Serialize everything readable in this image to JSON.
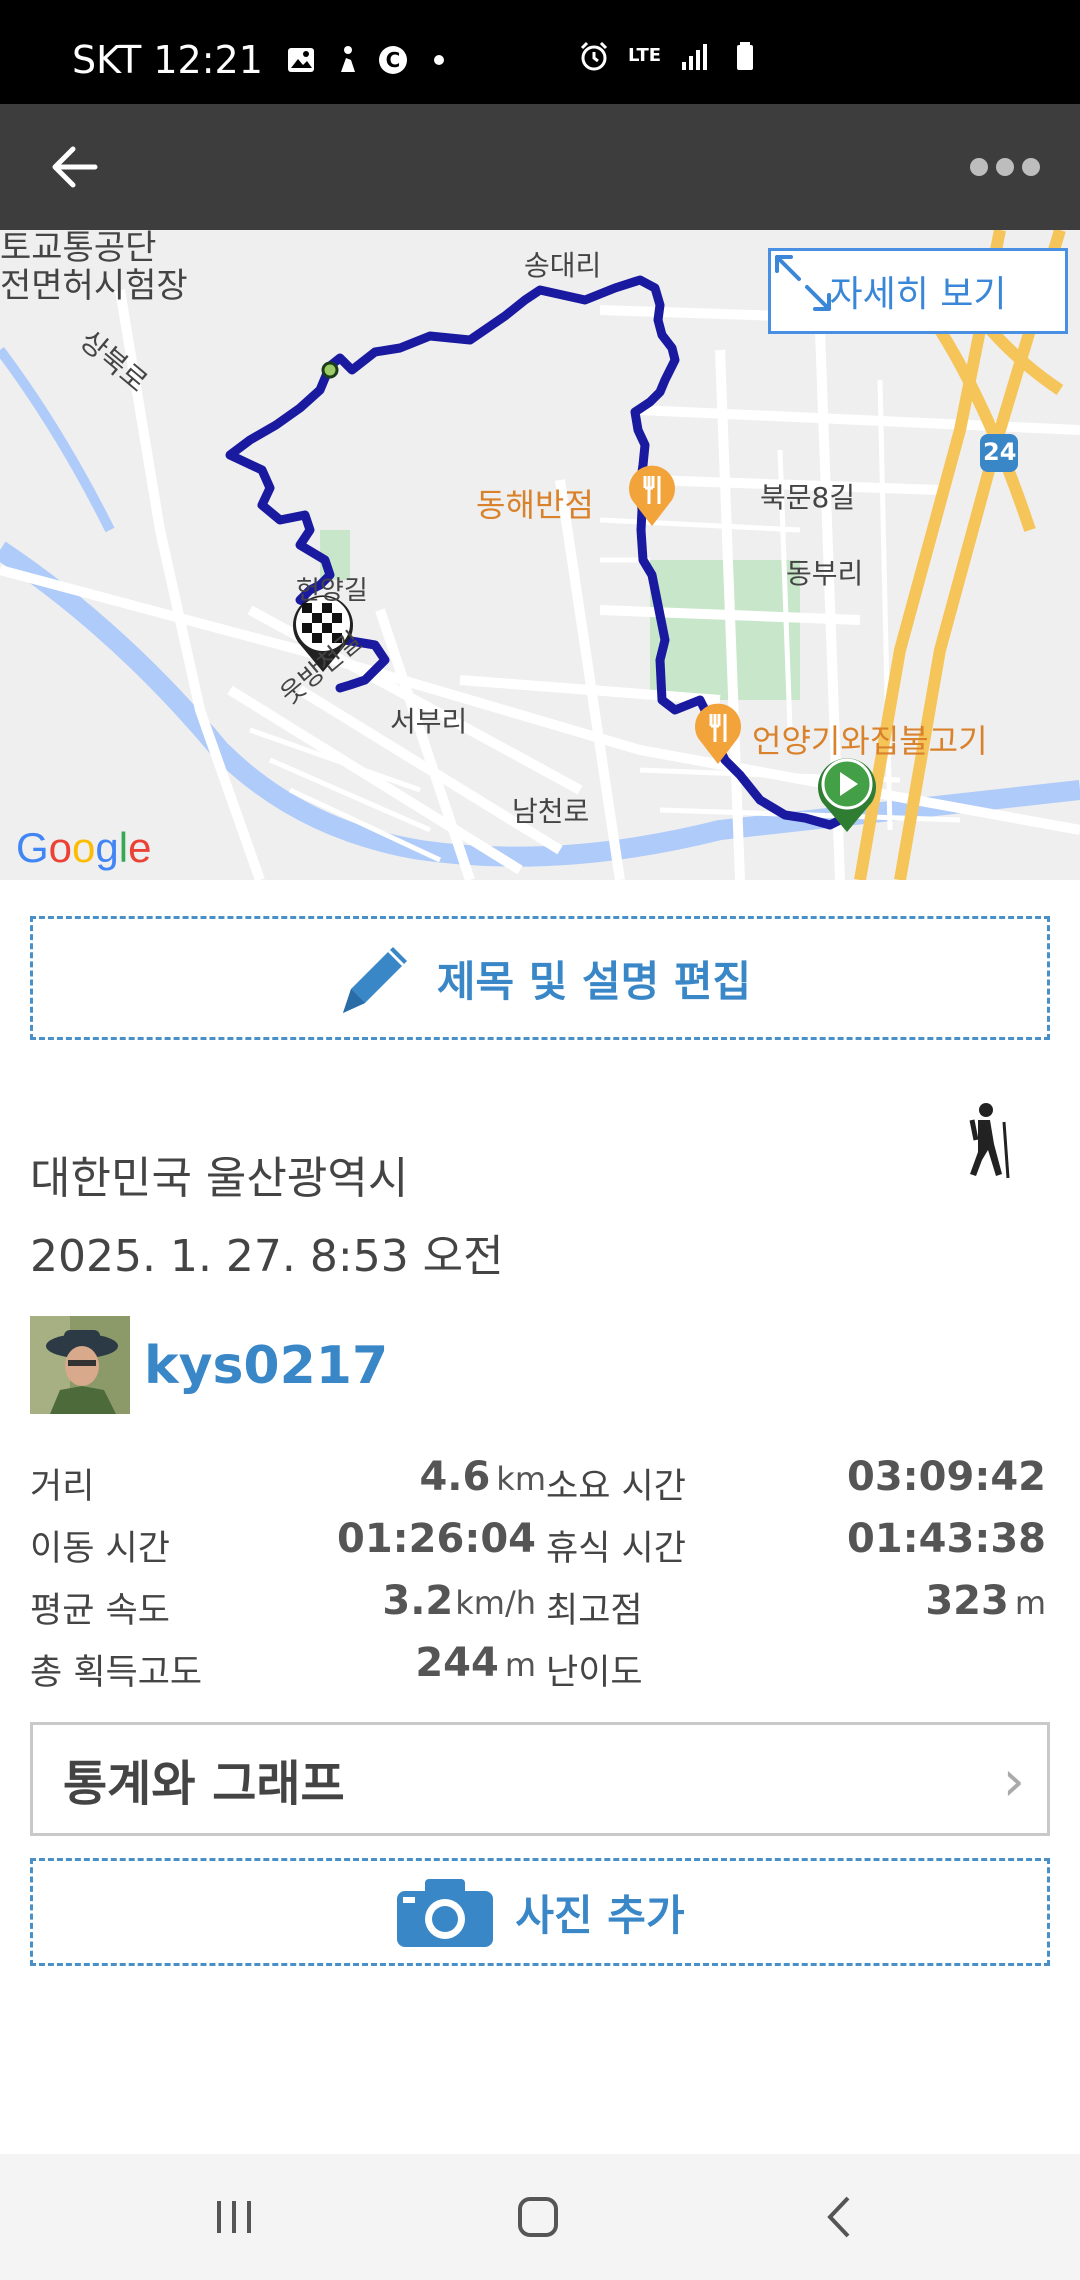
{
  "status_bar": {
    "carrier_time": "SKT 12:21",
    "network": "LTE"
  },
  "app_bar": {
    "back_icon": "back-arrow-icon",
    "more_icon": "more-dots-icon"
  },
  "map": {
    "detail_button_label": "자세히 보기",
    "labels": {
      "top_left_1": "토교통공단",
      "top_left_2": "전면허시험장",
      "songdaeri": "송대리",
      "sangbukro": "상북로",
      "bukmun8gil": "북문8길",
      "dongburi": "동부리",
      "heonyanggil": "헌양길",
      "ubangcheongil": "웃방천길",
      "seoburi": "서부리",
      "namcheonro": "남천로",
      "route_24": "24"
    },
    "pois": {
      "restaurant_1": "동해반점",
      "restaurant_2": "언양기와집불고기"
    },
    "logo": "Google"
  },
  "edit_button_label": "제목 및 설명 편집",
  "location": "대한민국 울산광역시",
  "datetime": "2025. 1. 27. 8:53 오전",
  "user": {
    "name": "kys0217"
  },
  "stats": {
    "distance": {
      "label": "거리",
      "value": "4.6",
      "unit": "km"
    },
    "duration": {
      "label": "소요 시간",
      "value": "03:09:42"
    },
    "moving_time": {
      "label": "이동 시간",
      "value": "01:26:04"
    },
    "rest_time": {
      "label": "휴식 시간",
      "value": "01:43:38"
    },
    "avg_speed": {
      "label": "평균 속도",
      "value": "3.2",
      "unit": "km/h"
    },
    "max_elevation": {
      "label": "최고점",
      "value": "323",
      "unit": "m"
    },
    "elevation_gain": {
      "label": "총 획득고도",
      "value": "244",
      "unit": "m"
    },
    "difficulty": {
      "label": "난이도",
      "value": ""
    }
  },
  "stats_button_label": "통계와 그래프",
  "add_photo_label": "사진 추가",
  "colors": {
    "accent": "#3a87c8",
    "route": "#1a1aa0",
    "app_bar": "#3d3d3d"
  }
}
